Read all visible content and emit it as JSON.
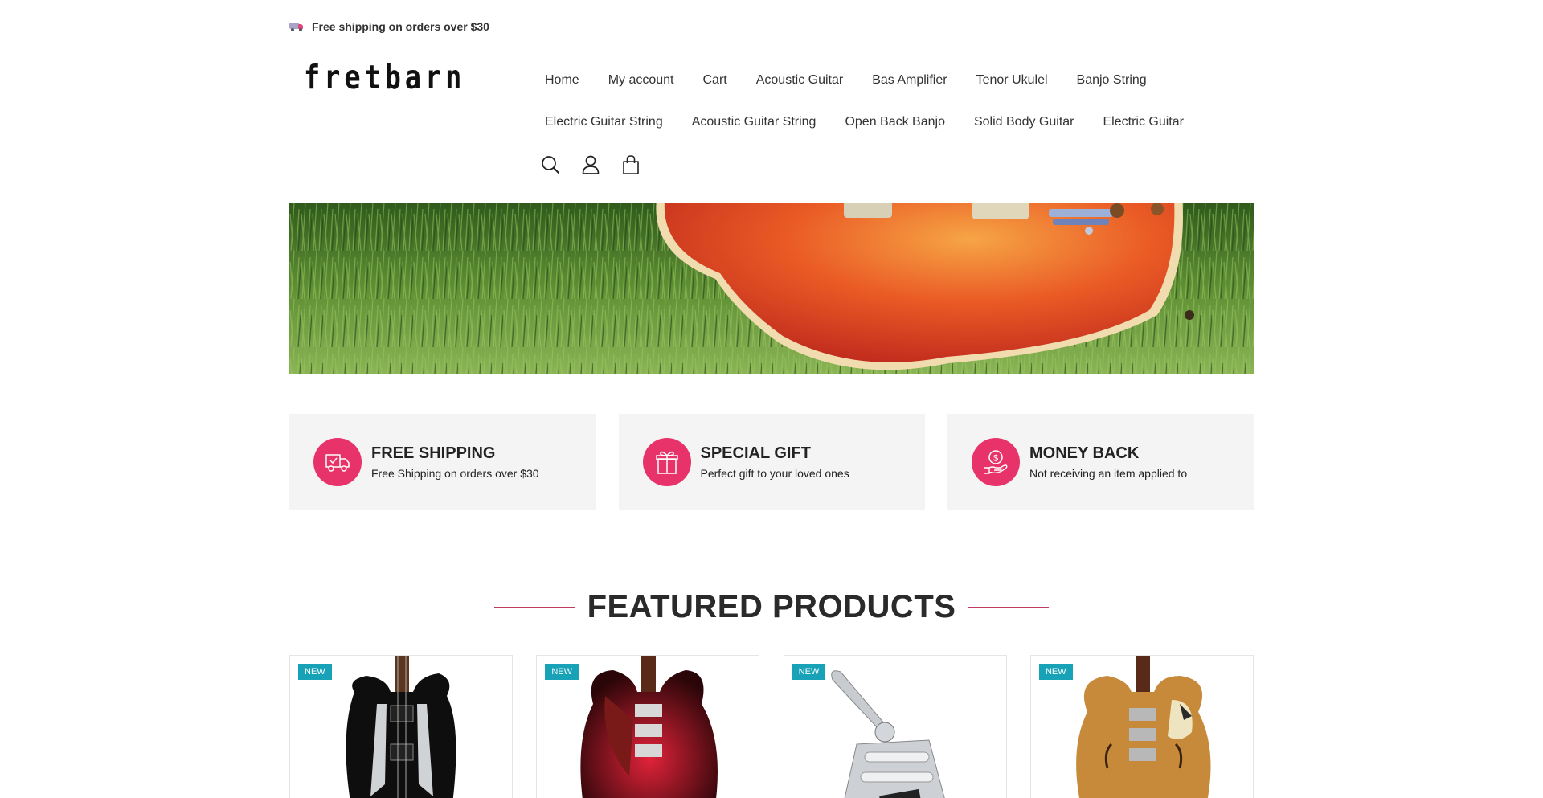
{
  "topbar": {
    "shipping_text": "Free shipping on orders over $30",
    "icon": "truck-icon"
  },
  "header": {
    "logo": "fretbarn",
    "nav_row1": [
      "Home",
      "My account",
      "Cart",
      "Acoustic Guitar",
      "Bas Amplifier",
      "Tenor Ukulel",
      "Banjo String"
    ],
    "nav_row2": [
      "Electric Guitar String",
      "Acoustic Guitar String",
      "Open Back Banjo",
      "Solid Body Guitar",
      "Electric Guitar"
    ],
    "icons": [
      "search-icon",
      "user-icon",
      "cart-bag-icon"
    ]
  },
  "features": [
    {
      "title": "FREE SHIPPING",
      "desc": "Free Shipping on orders over $30",
      "icon": "delivery-truck-icon"
    },
    {
      "title": "SPECIAL GIFT",
      "desc": "Perfect gift to your loved ones",
      "icon": "gift-icon"
    },
    {
      "title": "MONEY BACK",
      "desc": "Not receiving an item applied to",
      "icon": "money-hand-icon"
    }
  ],
  "featured": {
    "title": "FEATURED PRODUCTS"
  },
  "products": [
    {
      "badge": "NEW"
    },
    {
      "badge": "NEW"
    },
    {
      "badge": "NEW"
    },
    {
      "badge": "NEW"
    }
  ],
  "colors": {
    "accent": "#e8336a",
    "badge": "#17a2b8",
    "feature_bg": "#f4f4f4"
  }
}
